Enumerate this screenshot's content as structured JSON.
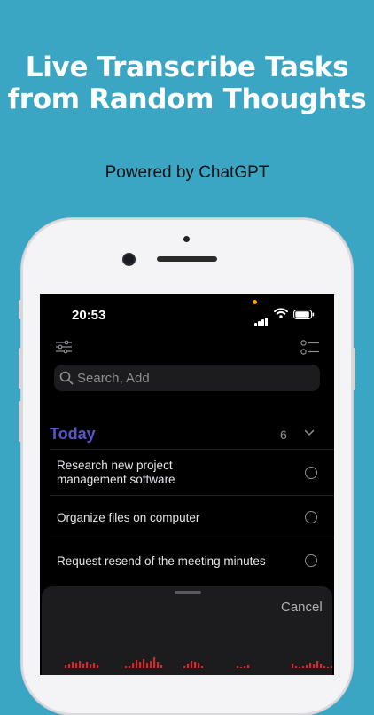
{
  "promo": {
    "headline_line1": "Live Transcribe Tasks",
    "headline_line2": "from Random Thoughts",
    "subline": "Powered by ChatGPT"
  },
  "status_bar": {
    "time": "20:53"
  },
  "toolbar": {
    "left_icon": "sliders-icon",
    "right_icon": "checklist-icon"
  },
  "search": {
    "placeholder": "Search, Add",
    "icon": "search-icon"
  },
  "section": {
    "title": "Today",
    "count": "6",
    "title_color": "#5a55c8"
  },
  "tasks": [
    {
      "line1": "Research new project",
      "line2": "management software"
    },
    {
      "line1": "Organize files on computer",
      "line2": ""
    },
    {
      "line1": "Request resend of the meeting minutes",
      "line2": ""
    }
  ],
  "sheet": {
    "cancel_label": "Cancel",
    "waveform_color": "#d42a2a"
  },
  "colors": {
    "background": "#3aa6c3",
    "screen": "#000000"
  }
}
